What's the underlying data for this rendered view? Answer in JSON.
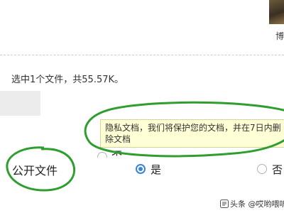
{
  "header": {
    "thumbnail_caption": "博"
  },
  "status": {
    "selection_info": "选中1个文件，共55.57K。"
  },
  "privacy": {
    "tooltip_text": "隐私文档，我们将保护您的文档，并在7日内删除文档",
    "field_label": "公开文件",
    "options": [
      {
        "label": "是",
        "selected": true
      },
      {
        "label": "否",
        "selected": false
      }
    ],
    "hidden_option_label": "否"
  },
  "watermark": {
    "text": "头条 @哎哟喂听说"
  },
  "colors": {
    "annotation_green": "#2f9e2f",
    "tooltip_bg": "#ffffd6",
    "radio_blue": "#3a84d8"
  }
}
